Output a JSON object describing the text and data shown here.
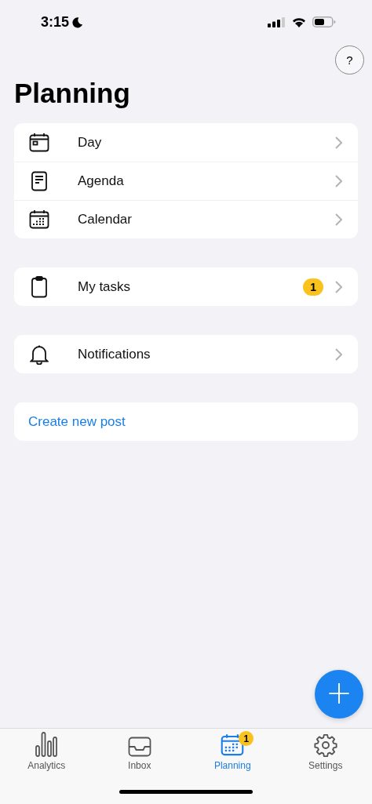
{
  "status_bar": {
    "time": "3:15"
  },
  "title": "Planning",
  "help_button": {
    "label": "?"
  },
  "groups": [
    {
      "items": [
        {
          "kind": "nav",
          "label": "Day"
        },
        {
          "kind": "nav",
          "label": "Agenda"
        },
        {
          "kind": "nav",
          "label": "Calendar"
        }
      ]
    },
    {
      "items": [
        {
          "kind": "nav",
          "label": "My tasks",
          "badge": "1"
        }
      ]
    },
    {
      "items": [
        {
          "kind": "nav",
          "label": "Notifications"
        }
      ]
    },
    {
      "items": [
        {
          "kind": "link",
          "label": "Create new post"
        }
      ]
    }
  ],
  "fab": {
    "label": "+"
  },
  "tabs": [
    {
      "label": "Analytics",
      "selected": false
    },
    {
      "label": "Inbox",
      "selected": false
    },
    {
      "label": "Planning",
      "selected": true,
      "badge": "1"
    },
    {
      "label": "Settings",
      "selected": false
    }
  ]
}
